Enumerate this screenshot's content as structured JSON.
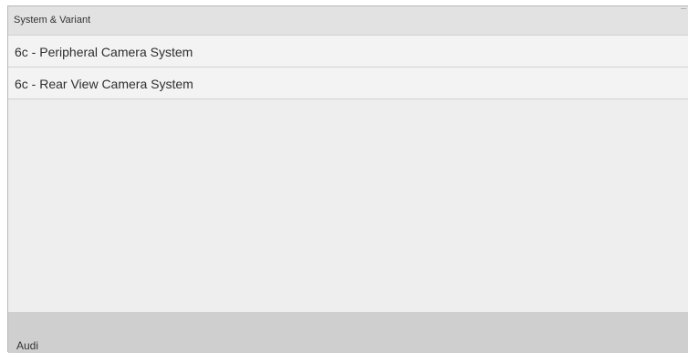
{
  "header": {
    "title": "System & Variant"
  },
  "list": {
    "items": [
      {
        "label": "6c - Peripheral Camera System"
      },
      {
        "label": "6c - Rear View Camera System"
      }
    ]
  },
  "footer": {
    "label": "Audi"
  },
  "colors": {
    "background": "#eeeeee",
    "header": "#e2e2e2",
    "list_item": "#f3f3f3",
    "footer": "#cfcfcf"
  }
}
